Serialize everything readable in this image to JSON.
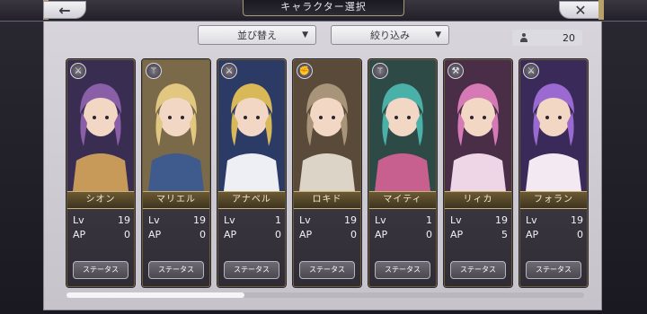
{
  "title": "キャラクター選択",
  "back_symbol": "←",
  "close_symbol": "✕",
  "sort": {
    "label": "並び替え",
    "arrow": "▼"
  },
  "filter": {
    "label": "絞り込み",
    "arrow": "▼"
  },
  "count": "20",
  "cards": [
    {
      "name": "シオン",
      "role_icon": "sword-icon",
      "lv_label": "Lv",
      "lv": "19",
      "ap_label": "AP",
      "ap": "0",
      "status_label": "ステータス",
      "palette": [
        "#3a2d52",
        "#8a5fa8",
        "#c79a5a"
      ]
    },
    {
      "name": "マリエル",
      "role_icon": "staff-icon",
      "lv_label": "Lv",
      "lv": "19",
      "ap_label": "AP",
      "ap": "0",
      "status_label": "ステータス",
      "palette": [
        "#7a6a4a",
        "#e2c780",
        "#3f5a8c"
      ]
    },
    {
      "name": "アナベル",
      "role_icon": "sword-icon",
      "lv_label": "Lv",
      "lv": "1",
      "ap_label": "AP",
      "ap": "0",
      "status_label": "ステータス",
      "palette": [
        "#2c3a66",
        "#d9b858",
        "#edeff4"
      ]
    },
    {
      "name": "ロキド",
      "role_icon": "fist-icon",
      "lv_label": "Lv",
      "lv": "19",
      "ap_label": "AP",
      "ap": "0",
      "status_label": "ステータス",
      "palette": [
        "#5a4a3a",
        "#a89478",
        "#dcd4c6"
      ]
    },
    {
      "name": "マイティ",
      "role_icon": "staff-icon",
      "lv_label": "Lv",
      "lv": "1",
      "ap_label": "AP",
      "ap": "0",
      "status_label": "ステータス",
      "palette": [
        "#2e4a46",
        "#4ab1a8",
        "#c7608f"
      ]
    },
    {
      "name": "リィカ",
      "role_icon": "axe-icon",
      "lv_label": "Lv",
      "lv": "19",
      "ap_label": "AP",
      "ap": "5",
      "status_label": "ステータス",
      "palette": [
        "#4a2e48",
        "#d67ab6",
        "#efd6e6"
      ]
    },
    {
      "name": "フォラン",
      "role_icon": "sword-icon",
      "lv_label": "Lv",
      "lv": "19",
      "ap_label": "AP",
      "ap": "0",
      "status_label": "ステータス",
      "palette": [
        "#3a2a5a",
        "#9a6ad0",
        "#f2e9f2"
      ]
    }
  ],
  "scroll": {
    "position": 0.0
  }
}
